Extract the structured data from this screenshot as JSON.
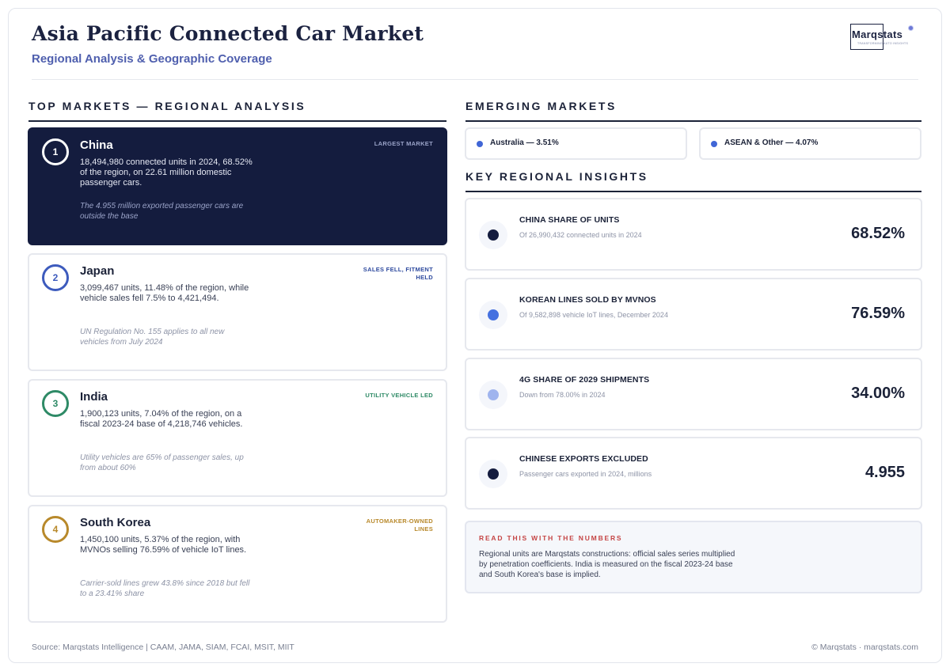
{
  "header": {
    "title": "Asia Pacific Connected Car Market",
    "subtitle": "Regional Analysis & Geographic Coverage",
    "logo_name": "Marqstats",
    "logo_tagline": "TRANSFORMING AUTO INSIGHTS"
  },
  "left_section": {
    "heading": "TOP MARKETS — REGIONAL ANALYSIS",
    "markets": [
      {
        "rank": "1",
        "name": "China",
        "tag": "LARGEST MARKET",
        "description": "18,494,980 connected units in 2024, 68.52% of the region, on 22.61 million domestic passenger cars.",
        "note": "The 4.955 million exported passenger cars are outside the base",
        "accent": "#ffffff",
        "tag_color": "#9aa3c8"
      },
      {
        "rank": "2",
        "name": "Japan",
        "tag": "SALES FELL, FITMENT HELD",
        "description": "3,099,467 units, 11.48% of the region, while vehicle sales fell 7.5% to 4,421,494.",
        "note": "UN Regulation No. 155 applies to all new vehicles from July 2024",
        "accent": "#3d5bbd",
        "tag_color": "#2e4a9e"
      },
      {
        "rank": "3",
        "name": "India",
        "tag": "UTILITY VEHICLE LED",
        "description": "1,900,123 units, 7.04% of the region, on a fiscal 2023-24 base of 4,218,746 vehicles.",
        "note": "Utility vehicles are 65% of passenger sales, up from about 60%",
        "accent": "#2e8a66",
        "tag_color": "#2e8a66"
      },
      {
        "rank": "4",
        "name": "South Korea",
        "tag": "AUTOMAKER-OWNED LINES",
        "description": "1,450,100 units, 5.37% of the region, with MVNOs selling 76.59% of vehicle IoT lines.",
        "note": "Carrier-sold lines grew 43.8% since 2018 but fell to a 23.41% share",
        "accent": "#b8892b",
        "tag_color": "#b8892b"
      }
    ]
  },
  "emerging": {
    "heading": "EMERGING MARKETS",
    "items": [
      {
        "label": "Australia — 3.51%"
      },
      {
        "label": "ASEAN & Other — 4.07%"
      }
    ]
  },
  "insights": {
    "heading": "KEY REGIONAL INSIGHTS",
    "items": [
      {
        "title": "CHINA SHARE OF UNITS",
        "subtitle": "Of 26,990,432 connected units in 2024",
        "value": "68.52%",
        "dot_color": "#141c3e"
      },
      {
        "title": "KOREAN LINES SOLD BY MVNOS",
        "subtitle": "Of 9,582,898 vehicle IoT lines, December 2024",
        "value": "76.59%",
        "dot_color": "#4571e0"
      },
      {
        "title": "4G SHARE OF 2029 SHIPMENTS",
        "subtitle": "Down from 78.00% in 2024",
        "value": "34.00%",
        "dot_color": "#9fb4ee"
      },
      {
        "title": "CHINESE EXPORTS EXCLUDED",
        "subtitle": "Passenger cars exported in 2024, millions",
        "value": "4.955",
        "dot_color": "#141c3e"
      }
    ]
  },
  "callout": {
    "title": "READ THIS WITH THE NUMBERS",
    "text": "Regional units are Marqstats constructions: official sales series multiplied by penetration coefficients. India is measured on the fiscal 2023-24 base and South Korea's base is implied."
  },
  "footer": {
    "source": "Source: Marqstats Intelligence | CAAM, JAMA, SIAM, FCAI, MSIT, MIIT",
    "copyright": "© Marqstats · marqstats.com"
  }
}
